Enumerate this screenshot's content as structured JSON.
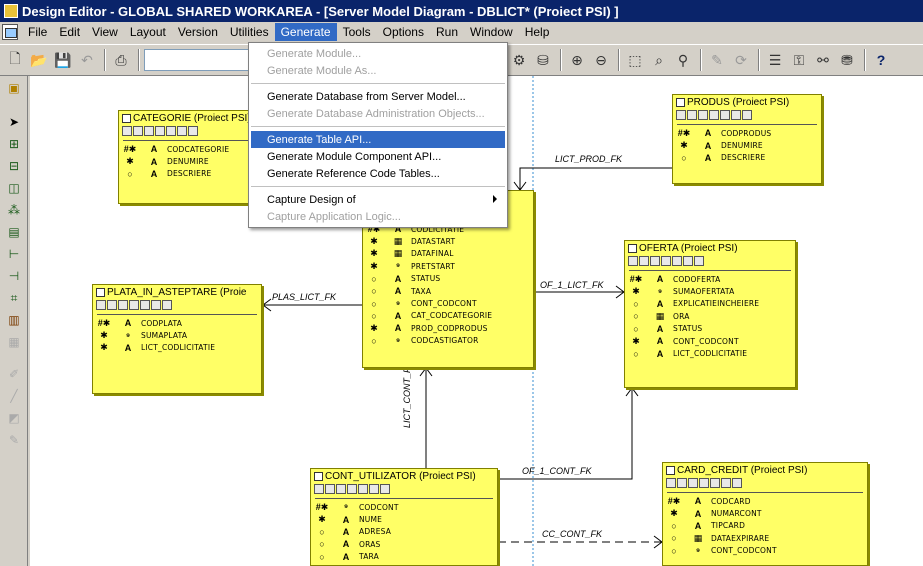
{
  "window": {
    "title": "Design Editor - GLOBAL SHARED WORKAREA - [Server Model Diagram - DBLICT* (Proiect PSI) ]"
  },
  "menu": {
    "items": [
      {
        "label": "File"
      },
      {
        "label": "Edit"
      },
      {
        "label": "View"
      },
      {
        "label": "Layout"
      },
      {
        "label": "Version"
      },
      {
        "label": "Utilities"
      },
      {
        "label": "Generate"
      },
      {
        "label": "Tools"
      },
      {
        "label": "Options"
      },
      {
        "label": "Run"
      },
      {
        "label": "Window"
      },
      {
        "label": "Help"
      }
    ],
    "active": "Generate"
  },
  "generate_menu": {
    "items": [
      {
        "label": "Generate Module...",
        "enabled": false
      },
      {
        "label": "Generate Module As...",
        "enabled": false
      },
      {
        "label": "Generate Database from Server Model...",
        "enabled": true
      },
      {
        "label": "Generate Database Administration Objects...",
        "enabled": false
      },
      {
        "label": "Generate Table API...",
        "enabled": true,
        "highlighted": true
      },
      {
        "label": "Generate Module Component API...",
        "enabled": true
      },
      {
        "label": "Generate Reference Code Tables...",
        "enabled": true
      },
      {
        "label": "Capture Design of",
        "enabled": true,
        "submenu": true
      },
      {
        "label": "Capture Application Logic...",
        "enabled": false
      }
    ]
  },
  "tables": {
    "categorie": {
      "title": "CATEGORIE (Proiect PSI)",
      "columns": [
        {
          "flag": "#✱",
          "type": "A",
          "name": "CODCATEGORIE"
        },
        {
          "flag": "✱",
          "type": "A",
          "name": "DENUMIRE"
        },
        {
          "flag": "○",
          "type": "A",
          "name": "DESCRIERE"
        }
      ]
    },
    "produs": {
      "title": "PRODUS (Proiect PSI)",
      "columns": [
        {
          "flag": "#✱",
          "type": "A",
          "name": "CODPRODUS"
        },
        {
          "flag": "✱",
          "type": "A",
          "name": "DENUMIRE"
        },
        {
          "flag": "○",
          "type": "A",
          "name": "DESCRIERE"
        }
      ]
    },
    "licitatie": {
      "columns": [
        {
          "flag": "#✱",
          "type": "A",
          "name": "CODLICITATIE"
        },
        {
          "flag": "✱",
          "type": "▦",
          "name": "DATASTART"
        },
        {
          "flag": "✱",
          "type": "▦",
          "name": "DATAFINAL"
        },
        {
          "flag": "✱",
          "type": "⁹",
          "name": "PRETSTART"
        },
        {
          "flag": "○",
          "type": "A",
          "name": "STATUS"
        },
        {
          "flag": "○",
          "type": "A",
          "name": "TAXA"
        },
        {
          "flag": "○",
          "type": "⁹",
          "name": "CONT_CODCONT"
        },
        {
          "flag": "○",
          "type": "A",
          "name": "CAT_CODCATEGORIE"
        },
        {
          "flag": "✱",
          "type": "A",
          "name": "PROD_CODPRODUS"
        },
        {
          "flag": "○",
          "type": "⁹",
          "name": "CODCASTIGATOR"
        }
      ]
    },
    "plata": {
      "title": "PLATA_IN_ASTEPTARE (Proie",
      "columns": [
        {
          "flag": "#✱",
          "type": "A",
          "name": "CODPLATA"
        },
        {
          "flag": "✱",
          "type": "⁹",
          "name": "SUMAPLATA"
        },
        {
          "flag": "✱",
          "type": "A",
          "name": "LICT_CODLICITATIE"
        }
      ]
    },
    "oferta": {
      "title": "OFERTA (Proiect PSI)",
      "columns": [
        {
          "flag": "#✱",
          "type": "A",
          "name": "CODOFERTA"
        },
        {
          "flag": "✱",
          "type": "⁹",
          "name": "SUMAOFERTATA"
        },
        {
          "flag": "○",
          "type": "A",
          "name": "EXPLICATIEINCHEIERE"
        },
        {
          "flag": "○",
          "type": "▦",
          "name": "ORA"
        },
        {
          "flag": "○",
          "type": "A",
          "name": "STATUS"
        },
        {
          "flag": "✱",
          "type": "A",
          "name": "CONT_CODCONT"
        },
        {
          "flag": "○",
          "type": "A",
          "name": "LICT_CODLICITATIE"
        }
      ]
    },
    "cont": {
      "title": "CONT_UTILIZATOR (Proiect PSI)",
      "columns": [
        {
          "flag": "#✱",
          "type": "⁹",
          "name": "CODCONT"
        },
        {
          "flag": "✱",
          "type": "A",
          "name": "NUME"
        },
        {
          "flag": "○",
          "type": "A",
          "name": "ADRESA"
        },
        {
          "flag": "○",
          "type": "A",
          "name": "ORAS"
        },
        {
          "flag": "○",
          "type": "A",
          "name": "TARA"
        }
      ]
    },
    "card": {
      "title": "CARD_CREDIT (Proiect PSI)",
      "columns": [
        {
          "flag": "#✱",
          "type": "A",
          "name": "CODCARD"
        },
        {
          "flag": "✱",
          "type": "A",
          "name": "NUMARCONT"
        },
        {
          "flag": "○",
          "type": "A",
          "name": "TIPCARD"
        },
        {
          "flag": "○",
          "type": "▦",
          "name": "DATAEXPIRARE"
        },
        {
          "flag": "○",
          "type": "⁹",
          "name": "CONT_CODCONT"
        }
      ]
    }
  },
  "relationships": {
    "lict_prod": "LICT_PROD_FK",
    "plas_lict": "PLAS_LICT_FK",
    "of_1_lict": "OF_1_LICT_FK",
    "lict_cont": "LICT_CONT_FK",
    "of_1_cont": "OF_1_CONT_FK",
    "cc_cont": "CC_CONT_FK"
  },
  "colors": {
    "table_fill": "#ffff66",
    "menu_highlight": "#316ac5",
    "titlebar": "#0a246a"
  }
}
